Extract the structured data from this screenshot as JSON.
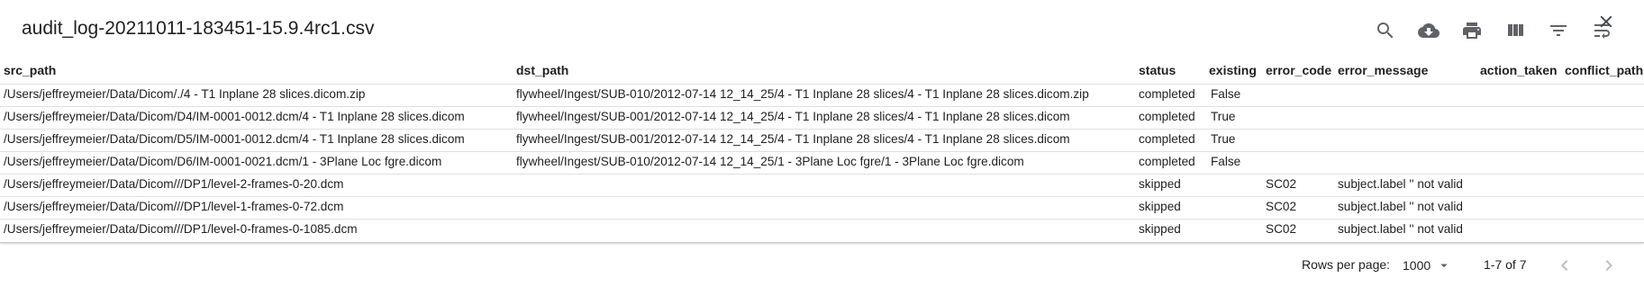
{
  "toolbar": {
    "title": "audit_log-20211011-183451-15.9.4rc1.csv",
    "icons": [
      "search-icon",
      "download-icon",
      "print-icon",
      "view-columns-icon",
      "filter-icon",
      "wrap-text-icon",
      "close-icon"
    ]
  },
  "table": {
    "columns": [
      "src_path",
      "dst_path",
      "status",
      "existing",
      "error_code",
      "error_message",
      "action_taken",
      "conflict_path"
    ],
    "rows": [
      [
        "/Users/jeffreymeier/Data/Dicom/./4 - T1 Inplane 28 slices.dicom.zip",
        "flywheel/Ingest/SUB-010/2012-07-14 12_14_25/4 - T1 Inplane 28 slices/4 - T1 Inplane 28 slices.dicom.zip",
        "completed",
        "False",
        "",
        "",
        "",
        ""
      ],
      [
        "/Users/jeffreymeier/Data/Dicom/D4/IM-0001-0012.dcm/4 - T1 Inplane 28 slices.dicom",
        "flywheel/Ingest/SUB-001/2012-07-14 12_14_25/4 - T1 Inplane 28 slices/4 - T1 Inplane 28 slices.dicom",
        "completed",
        "True",
        "",
        "",
        "",
        ""
      ],
      [
        "/Users/jeffreymeier/Data/Dicom/D5/IM-0001-0012.dcm/4 - T1 Inplane 28 slices.dicom",
        "flywheel/Ingest/SUB-001/2012-07-14 12_14_25/4 - T1 Inplane 28 slices/4 - T1 Inplane 28 slices.dicom",
        "completed",
        "True",
        "",
        "",
        "",
        ""
      ],
      [
        "/Users/jeffreymeier/Data/Dicom/D6/IM-0001-0021.dcm/1 - 3Plane Loc fgre.dicom",
        "flywheel/Ingest/SUB-010/2012-07-14 12_14_25/1 - 3Plane Loc fgre/1 - 3Plane Loc fgre.dicom",
        "completed",
        "False",
        "",
        "",
        "",
        ""
      ],
      [
        "/Users/jeffreymeier/Data/Dicom///DP1/level-2-frames-0-20.dcm",
        "",
        "skipped",
        "",
        "SC02",
        "subject.label '' not valid",
        "",
        ""
      ],
      [
        "/Users/jeffreymeier/Data/Dicom///DP1/level-1-frames-0-72.dcm",
        "",
        "skipped",
        "",
        "SC02",
        "subject.label '' not valid",
        "",
        ""
      ],
      [
        "/Users/jeffreymeier/Data/Dicom///DP1/level-0-frames-0-1085.dcm",
        "",
        "skipped",
        "",
        "SC02",
        "subject.label '' not valid",
        "",
        ""
      ]
    ]
  },
  "footer": {
    "rows_per_page_label": "Rows per page:",
    "rows_per_page_value": "1000",
    "range": "1-7 of 7"
  }
}
